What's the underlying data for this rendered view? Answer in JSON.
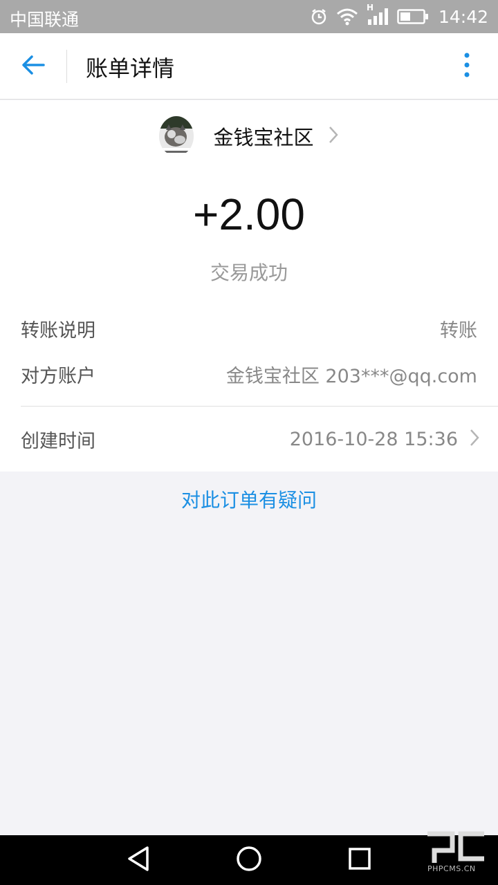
{
  "status_bar": {
    "carrier": "中国联通",
    "network_indicator": "H",
    "time": "14:42",
    "icons": [
      "alarm-icon",
      "wifi-icon",
      "signal-icon",
      "battery-icon"
    ]
  },
  "header": {
    "title": "账单详情",
    "back_icon": "back-arrow-icon",
    "more_icon": "more-vertical-icon"
  },
  "merchant": {
    "name": "金钱宝社区",
    "avatar_icon": "cat-avatar"
  },
  "transaction": {
    "amount": "+2.00",
    "status": "交易成功"
  },
  "details": {
    "memo_label": "转账说明",
    "memo_value": "转账",
    "account_label": "对方账户",
    "account_value": "金钱宝社区 203***@qq.com",
    "created_label": "创建时间",
    "created_value": "2016-10-28 15:36"
  },
  "question_link": "对此订单有疑问",
  "watermark": {
    "text": "PHPCMS.CN"
  },
  "colors": {
    "status_bar": "#a9a9a9",
    "accent": "#1b8fe3",
    "page_bg": "#f3f3f7"
  }
}
